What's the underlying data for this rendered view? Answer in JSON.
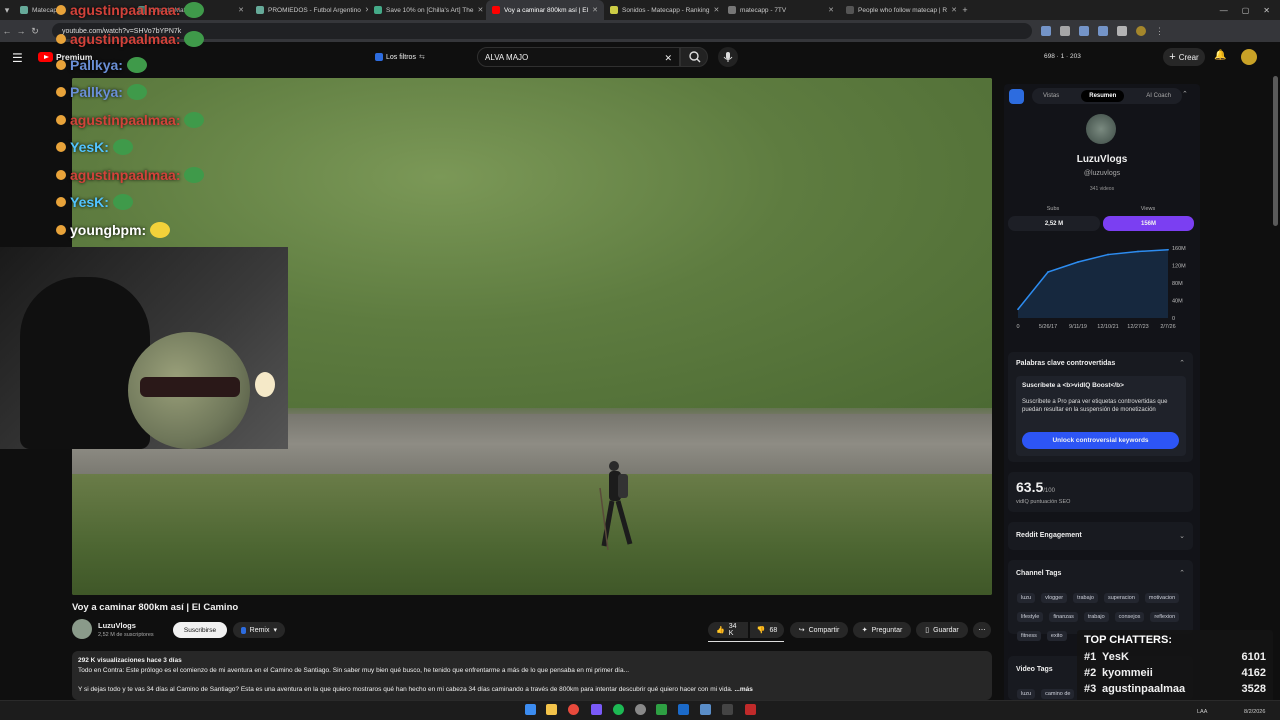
{
  "browser": {
    "tabs": [
      {
        "label": "Matecap"
      },
      {
        "label": "Chat de Mate"
      },
      {
        "label": "PROMIEDOS - Futbol Argentino"
      },
      {
        "label": "Save 10% on [Chilla's Art] The"
      },
      {
        "label": "Voy a caminar 800km así | El"
      },
      {
        "label": "Sonidos - Matecapp - Ranking"
      },
      {
        "label": "matecapp - 7TV"
      },
      {
        "label": "People who follow matecap | R"
      }
    ],
    "url": "youtube.com/watch?v=SHVo7bYPN7k"
  },
  "youtube": {
    "premium_label": "Premium",
    "filters_label": "Los filtros",
    "search_value": "ALVA MAJO",
    "stats": "698 · 1 · 203",
    "create_label": "Crear"
  },
  "chat": [
    {
      "user": "agustinpaalmaa:",
      "color": "#d3423a"
    },
    {
      "user": "agustinpaalmaa:",
      "color": "#d3423a"
    },
    {
      "user": "Pallkya:",
      "color": "#6a8fd6"
    },
    {
      "user": "Pallkya:",
      "color": "#6a8fd6"
    },
    {
      "user": "agustinpaalmaa:",
      "color": "#d3423a"
    },
    {
      "user": "YesK:",
      "color": "#52c4ff"
    },
    {
      "user": "agustinpaalmaa:",
      "color": "#d3423a"
    },
    {
      "user": "YesK:",
      "color": "#52c4ff"
    },
    {
      "user": "youngbpm:",
      "color": "#ffffff"
    }
  ],
  "video": {
    "title": "Voy a caminar 800km así | El Camino",
    "channel": "LuzuVlogs",
    "subscribers": "2,52 M de suscriptores",
    "subscribe_label": "Suscribirse",
    "remix_label": "Remix",
    "likes": "34 K",
    "dislikes": "68",
    "share_label": "Compartir",
    "ask_label": "Preguntar",
    "save_label": "Guardar",
    "views_line": "292 K visualizaciones  hace 3 días",
    "desc1": "Todo en Contra: Este prólogo es el comienzo de mi aventura en el Camino de Santiago. Sin saber muy bien qué busco, he tenido que enfrentarme a más de lo que pensaba en mi primer día...",
    "desc2": "Y si dejas todo y te vas 34 días al Camino de Santiago? Esta es una aventura en la que quiero mostraros qué han hecho en mi cabeza 34 días caminando a través de 800km para intentar descubrir qué quiero hacer con mi vida.",
    "more_label": "...más"
  },
  "vidiq": {
    "tabs": [
      "Vistas",
      "Resumen",
      "AI Coach"
    ],
    "channel_name": "LuzuVlogs",
    "handle": "@luzuvlogs",
    "videos": "341 videos",
    "subs_label": "Subs",
    "views_label": "Views",
    "subs_value": "2,52 M",
    "views_value": "156M",
    "keywords_title": "Palabras clave controvertidas",
    "boost_title": "Suscríbete a <b>vidIQ Boost</b>",
    "boost_text": "Suscríbete a Pro para ver etiquetas controvertidas que puedan resultar en la suspensión de monetización",
    "unlock_label": "Unlock controversial keywords",
    "seo_score": "63.5",
    "seo_max": "/100",
    "seo_label": "vidIQ puntuación SEO",
    "reddit_label": "Reddit Engagement",
    "channel_tags_label": "Channel Tags",
    "tags": [
      "luzu",
      "vlogger",
      "trabajo",
      "superacion",
      "motivacion",
      "lifestyle",
      "finanzas",
      "trabajo",
      "consejos",
      "reflexion",
      "fitness",
      "exito"
    ],
    "video_tags_label": "Video Tags",
    "video_tags": [
      "luzu",
      "camino de"
    ]
  },
  "chart_data": {
    "type": "area",
    "x": [
      "0",
      "5/26/17",
      "9/11/19",
      "12/10/21",
      "12/27/23",
      "2/7/26"
    ],
    "ytick_labels": [
      "0",
      "40M",
      "80M",
      "120M",
      "160M"
    ],
    "ylim": [
      0,
      160
    ],
    "series": [
      {
        "values": [
          20,
          105,
          128,
          145,
          152,
          156
        ]
      }
    ],
    "color": "#2d8cf0"
  },
  "top_chatters": {
    "title": "TOP CHATTERS:",
    "rows": [
      {
        "rank": "#1",
        "name": "YesK",
        "count": "6101"
      },
      {
        "rank": "#2",
        "name": "kyommeii",
        "count": "4162"
      },
      {
        "rank": "#3",
        "name": "agustinpaalmaa",
        "count": "3528"
      }
    ]
  },
  "taskbar": {
    "lang": "LAA",
    "date": "8/2/2026"
  }
}
